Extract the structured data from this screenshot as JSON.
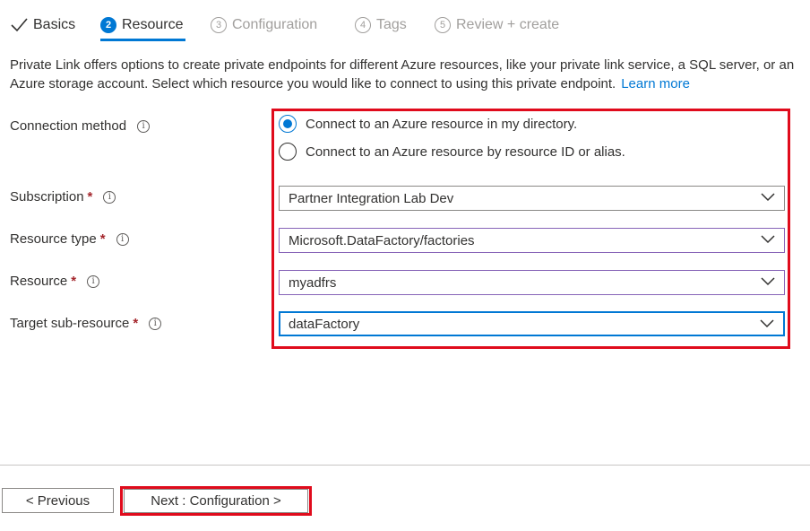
{
  "tabs": [
    {
      "label": "Basics",
      "state": "done"
    },
    {
      "number": "2",
      "label": "Resource",
      "state": "active"
    },
    {
      "number": "3",
      "label": "Configuration",
      "state": "disabled"
    },
    {
      "number": "4",
      "label": "Tags",
      "state": "disabled"
    },
    {
      "number": "5",
      "label": "Review + create",
      "state": "disabled"
    }
  ],
  "description": {
    "text": "Private Link offers options to create private endpoints for different Azure resources, like your private link service, a SQL server, or an Azure storage account. Select which resource you would like to connect to using this private endpoint.",
    "link": "Learn more"
  },
  "form": {
    "connection_method": {
      "label": "Connection method",
      "options": [
        {
          "label": "Connect to an Azure resource in my directory.",
          "checked": true
        },
        {
          "label": "Connect to an Azure resource by resource ID or alias.",
          "checked": false
        }
      ]
    },
    "subscription": {
      "label": "Subscription",
      "required": "*",
      "value": "Partner Integration Lab Dev"
    },
    "resource_type": {
      "label": "Resource type",
      "required": "*",
      "value": "Microsoft.DataFactory/factories"
    },
    "resource": {
      "label": "Resource",
      "required": "*",
      "value": "myadfrs"
    },
    "target_sub_resource": {
      "label": "Target sub-resource",
      "required": "*",
      "value": "dataFactory"
    }
  },
  "footer": {
    "previous_label": "< Previous",
    "next_label": "Next : Configuration >"
  },
  "colors": {
    "accent": "#0078d4",
    "highlight": "#e00b1c",
    "required": "#a4262c"
  },
  "icons": {
    "check": "checkmark-icon",
    "info": "info-icon",
    "chevron": "chevron-down-icon"
  }
}
